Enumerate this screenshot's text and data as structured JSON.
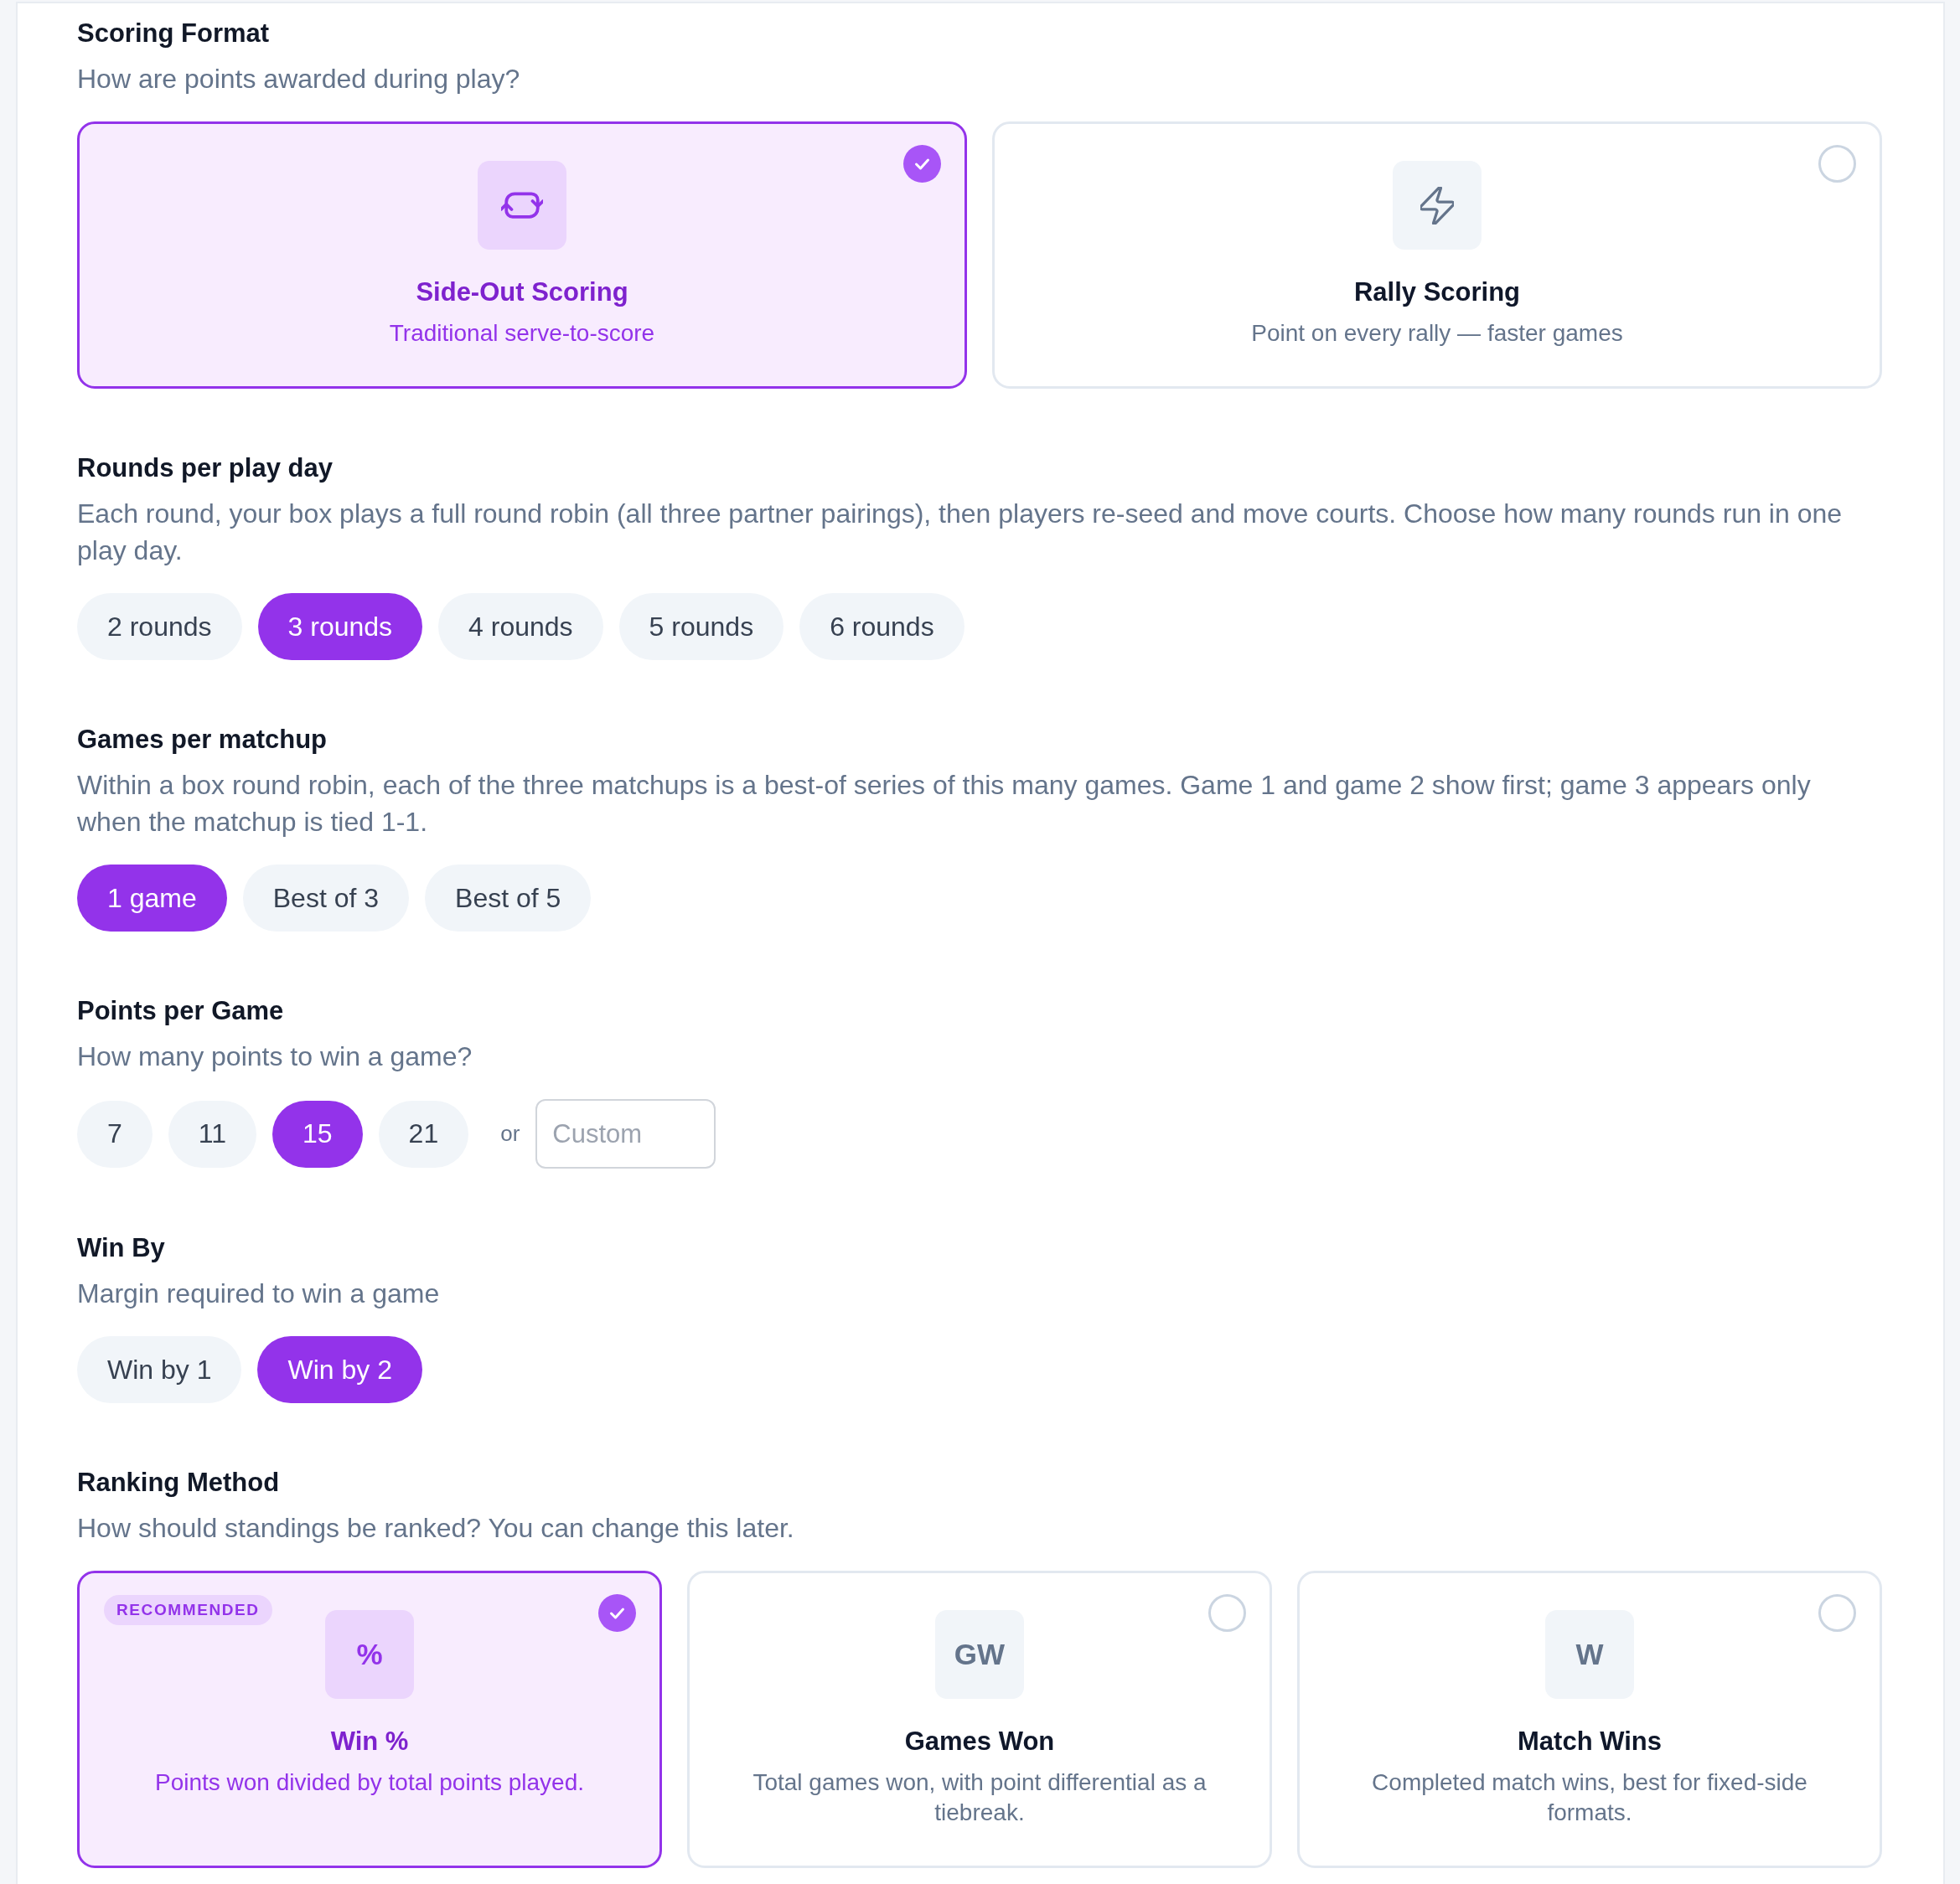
{
  "sections": [
    {
      "kind": "cards",
      "title": "Scoring Format",
      "description": "How are points awarded during play?",
      "options": [
        {
          "title": "Side-Out Scoring",
          "description": "Traditional serve-to-score",
          "selected": true
        },
        {
          "title": "Rally Scoring",
          "description": "Point on every rally — faster games",
          "selected": false
        }
      ]
    },
    {
      "kind": "chips",
      "title": "Rounds per play day",
      "description": "Each round, your box plays a full round robin (all three partner pairings), then players re-seed and move courts. Choose how many rounds run in one play day.",
      "options": [
        {
          "label": "2 rounds",
          "selected": false
        },
        {
          "label": "3 rounds",
          "selected": true
        },
        {
          "label": "4 rounds",
          "selected": false
        },
        {
          "label": "5 rounds",
          "selected": false
        },
        {
          "label": "6 rounds",
          "selected": false
        }
      ]
    },
    {
      "kind": "chips",
      "title": "Games per matchup",
      "description": "Within a box round robin, each of the three matchups is a best-of series of this many games. Game 1 and game 2 show first; game 3 appears only when the matchup is tied 1-1.",
      "options": [
        {
          "label": "1 game",
          "selected": true
        },
        {
          "label": "Best of 3",
          "selected": false
        },
        {
          "label": "Best of 5",
          "selected": false
        }
      ]
    },
    {
      "kind": "chips",
      "title": "Points per Game",
      "description": "How many points to win a game?",
      "options": [
        {
          "label": "7",
          "selected": false
        },
        {
          "label": "11",
          "selected": false
        },
        {
          "label": "15",
          "selected": true
        },
        {
          "label": "21",
          "selected": false
        }
      ],
      "separator": "or",
      "custom": {
        "placeholder": "Custom"
      }
    },
    {
      "kind": "chips",
      "title": "Win By",
      "description": "Margin required to win a game",
      "options": [
        {
          "label": "Win by 1",
          "selected": false
        },
        {
          "label": "Win by 2",
          "selected": true
        }
      ]
    },
    {
      "kind": "cards",
      "title": "Ranking Method",
      "description": "How should standings be ranked? You can change this later.",
      "options": [
        {
          "badge": "RECOMMENDED",
          "glyph": "%",
          "title": "Win %",
          "description": "Points won divided by total points played.",
          "selected": true
        },
        {
          "glyph": "GW",
          "title": "Games Won",
          "description": "Total games won, with point differential as a tiebreak.",
          "selected": false
        },
        {
          "glyph": "W",
          "title": "Match Wins",
          "description": "Completed match wins, best for fixed-side formats.",
          "selected": false
        }
      ]
    }
  ]
}
